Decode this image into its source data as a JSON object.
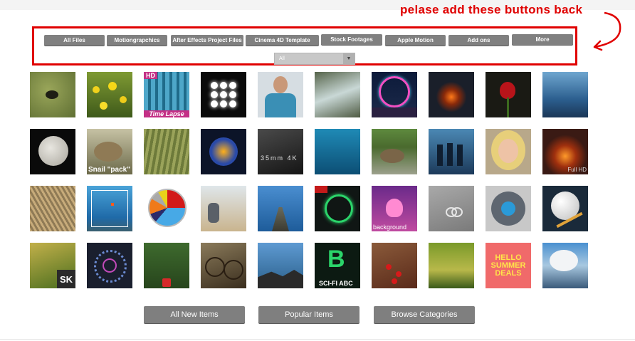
{
  "annotation": {
    "text": "pelase add these buttons back",
    "color": "#e00000"
  },
  "filters": {
    "buttons": [
      "All Files",
      "Motiongrapchics",
      "After Effects Project Files",
      "Cinema 4D Template",
      "Stock Footages",
      "Apple Motion",
      "Add ons",
      "More"
    ],
    "select": {
      "value": "All"
    }
  },
  "grid": {
    "items": [
      {
        "name": "golf-hole"
      },
      {
        "name": "dandelions"
      },
      {
        "name": "time-lapse-building",
        "badge": "HD",
        "caption": "Time Lapse"
      },
      {
        "name": "light-dots"
      },
      {
        "name": "man-portrait"
      },
      {
        "name": "waterfall"
      },
      {
        "name": "ferris-wheel"
      },
      {
        "name": "campfire"
      },
      {
        "name": "red-rose"
      },
      {
        "name": "sea-shore"
      },
      {
        "name": "moon"
      },
      {
        "name": "snail-pack",
        "caption": "Snail \"pack\""
      },
      {
        "name": "grass"
      },
      {
        "name": "burning-sphere"
      },
      {
        "name": "keyboard-35mm",
        "caption": "35mm 4K"
      },
      {
        "name": "underwater-swimmer"
      },
      {
        "name": "snail"
      },
      {
        "name": "silhouettes"
      },
      {
        "name": "blonde-woman"
      },
      {
        "name": "fireplace",
        "caption": "Full HD"
      },
      {
        "name": "wheat-field"
      },
      {
        "name": "skydiver"
      },
      {
        "name": "pie-chart"
      },
      {
        "name": "man-sitting-beach"
      },
      {
        "name": "pier-person"
      },
      {
        "name": "green-tech-ui"
      },
      {
        "name": "flower-duotone",
        "caption": "background"
      },
      {
        "name": "rings"
      },
      {
        "name": "logo-reveal"
      },
      {
        "name": "golf-ball"
      },
      {
        "name": "grass-stalks",
        "badge": "SK"
      },
      {
        "name": "circle-hud"
      },
      {
        "name": "plant-pot"
      },
      {
        "name": "bicycles"
      },
      {
        "name": "rocks-sea"
      },
      {
        "name": "scifi-abc",
        "caption": "SCI-FI ABC"
      },
      {
        "name": "ladybugs"
      },
      {
        "name": "forest-lake"
      },
      {
        "name": "summer-deals",
        "caption": "HELLO SUMMER DEALS"
      },
      {
        "name": "clouds-city"
      }
    ]
  },
  "bottom_buttons": [
    "All New Items",
    "Popular Items",
    "Browse Categories"
  ]
}
